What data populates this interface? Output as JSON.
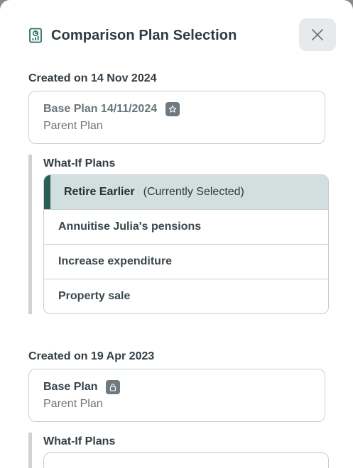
{
  "dialog": {
    "title": "Comparison Plan Selection",
    "close_label": "Close"
  },
  "groups": [
    {
      "heading": "Created on 14 Nov 2024",
      "base_plan": {
        "name": "Base Plan 14/11/2024",
        "subtitle": "Parent Plan",
        "badge_icon": "star-icon"
      },
      "whatif_heading": "What-If Plans",
      "whatif_plans": [
        {
          "name": "Retire Earlier",
          "note": "(Currently Selected)",
          "selected": true
        },
        {
          "name": "Annuitise Julia's pensions",
          "selected": false
        },
        {
          "name": "Increase expenditure",
          "selected": false
        },
        {
          "name": "Property sale",
          "selected": false
        }
      ]
    },
    {
      "heading": "Created on 19 Apr 2023",
      "base_plan": {
        "name": "Base Plan",
        "subtitle": "Parent Plan",
        "badge_icon": "lock-icon"
      },
      "whatif_heading": "What-If Plans",
      "whatif_plans": []
    }
  ],
  "colors": {
    "selected_bg": "#d1e0de",
    "selected_accent": "#2a5e56",
    "badge_bg": "#6e7a80",
    "icon_teal": "#2a6b64"
  }
}
